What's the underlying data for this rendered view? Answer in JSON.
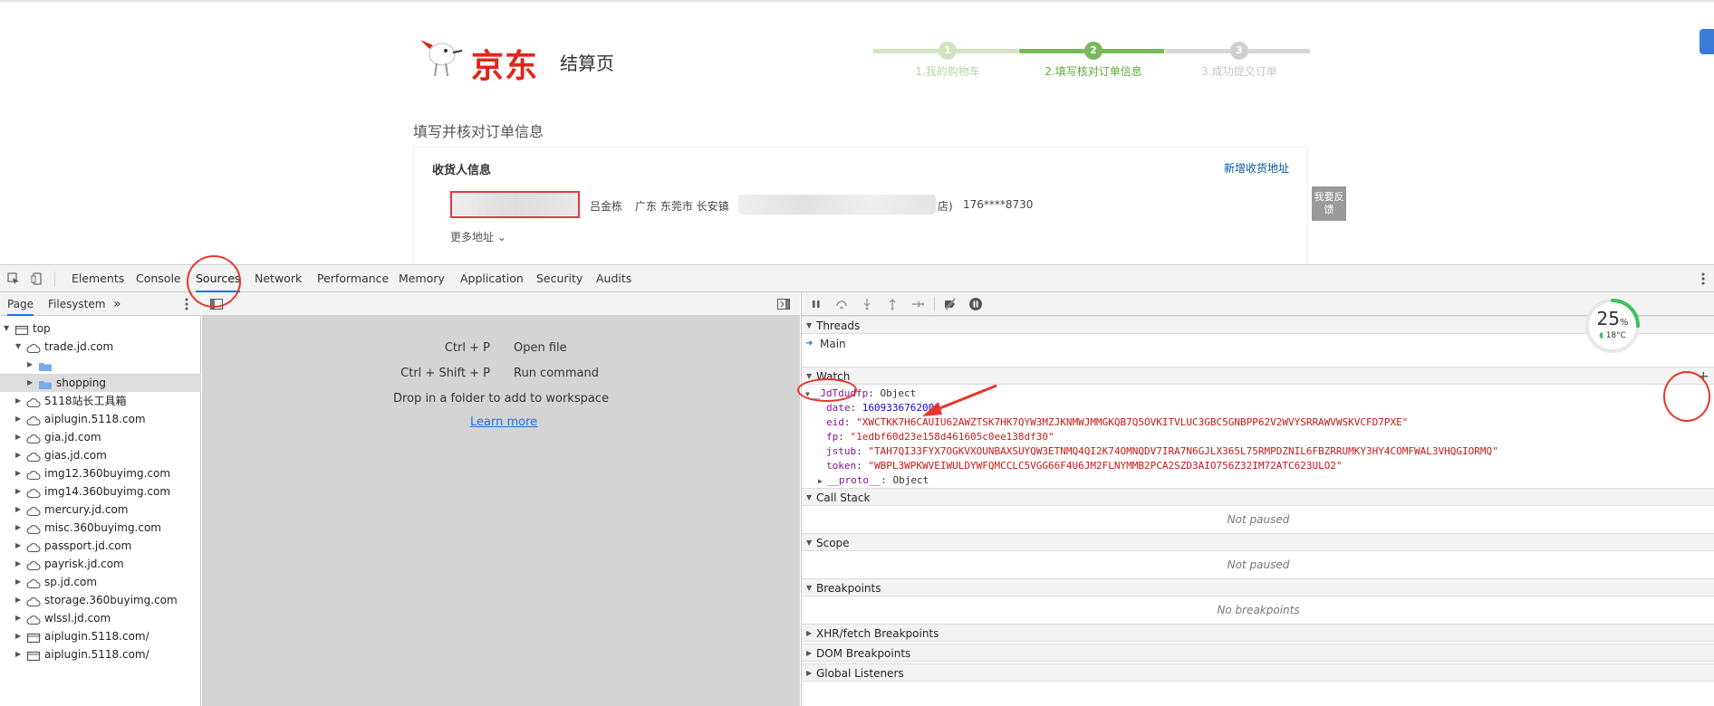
{
  "jd": {
    "brand": "京东",
    "page_subtitle": "结算页",
    "steps": [
      {
        "num": "1",
        "label": "1.我的购物车"
      },
      {
        "num": "2",
        "label": "2.填写核对订单信息"
      },
      {
        "num": "3",
        "label": "3.成功提交订单"
      }
    ],
    "section_title": "填写并核对订单信息",
    "receiver_title": "收货人信息",
    "add_address": "新增收货地址",
    "receiver_name": "吕金栋",
    "address_start": "广东 东莞市 长安镇",
    "address_end": "店)",
    "phone": "176****8730",
    "more_address": "更多地址",
    "feedback_label": "我要反馈"
  },
  "devtools": {
    "tabs": [
      "Elements",
      "Console",
      "Sources",
      "Network",
      "Performance",
      "Memory",
      "Application",
      "Security",
      "Audits"
    ],
    "active_tab": "Sources",
    "nav_tabs": [
      "Page",
      "Filesystem"
    ],
    "nav_more": "»",
    "tree": [
      {
        "label": "top",
        "indent": 0,
        "icon": "frame-icon",
        "expanded": true
      },
      {
        "label": "trade.jd.com",
        "indent": 1,
        "icon": "cloud-icon",
        "expanded": true
      },
      {
        "label": "",
        "indent": 2,
        "icon": "folder-icon",
        "expanded": false
      },
      {
        "label": "shopping",
        "indent": 2,
        "icon": "folder-icon",
        "expanded": false,
        "selected": true
      },
      {
        "label": "5118站长工具箱",
        "indent": 1,
        "icon": "cloud-icon",
        "expanded": false
      },
      {
        "label": "aiplugin.5118.com",
        "indent": 1,
        "icon": "cloud-icon",
        "expanded": false
      },
      {
        "label": "gia.jd.com",
        "indent": 1,
        "icon": "cloud-icon",
        "expanded": false
      },
      {
        "label": "gias.jd.com",
        "indent": 1,
        "icon": "cloud-icon",
        "expanded": false
      },
      {
        "label": "img12.360buyimg.com",
        "indent": 1,
        "icon": "cloud-icon",
        "expanded": false
      },
      {
        "label": "img14.360buyimg.com",
        "indent": 1,
        "icon": "cloud-icon",
        "expanded": false
      },
      {
        "label": "mercury.jd.com",
        "indent": 1,
        "icon": "cloud-icon",
        "expanded": false
      },
      {
        "label": "misc.360buyimg.com",
        "indent": 1,
        "icon": "cloud-icon",
        "expanded": false
      },
      {
        "label": "passport.jd.com",
        "indent": 1,
        "icon": "cloud-icon",
        "expanded": false
      },
      {
        "label": "payrisk.jd.com",
        "indent": 1,
        "icon": "cloud-icon",
        "expanded": false
      },
      {
        "label": "sp.jd.com",
        "indent": 1,
        "icon": "cloud-icon",
        "expanded": false
      },
      {
        "label": "storage.360buyimg.com",
        "indent": 1,
        "icon": "cloud-icon",
        "expanded": false
      },
      {
        "label": "wlssl.jd.com",
        "indent": 1,
        "icon": "cloud-icon",
        "expanded": false
      },
      {
        "label": "aiplugin.5118.com/",
        "indent": 1,
        "icon": "frame-icon",
        "expanded": false
      },
      {
        "label": "aiplugin.5118.com/",
        "indent": 1,
        "icon": "frame-icon",
        "expanded": false
      }
    ],
    "editor": {
      "shortcuts": [
        {
          "keys": "Ctrl + P",
          "action": "Open file"
        },
        {
          "keys": "Ctrl + Shift + P",
          "action": "Run command"
        }
      ],
      "drop_hint": "Drop in a folder to add to workspace",
      "learn_more": "Learn more"
    },
    "threads": {
      "title": "Threads",
      "main": "Main"
    },
    "watch": {
      "title": "Watch",
      "add": "+",
      "expr": "_JdTdudfp",
      "expr_type": "Object",
      "props": [
        {
          "key": "date",
          "value": "1609336762000",
          "kind": "num"
        },
        {
          "key": "eid",
          "value": "\"XWCTKK7H6CAUIU62AWZTSK7HK7QYW3MZJKNMWJMMGKQB7Q5OVKITVLUC3GBC5GNBPP62V2WVYSRRAWVWSKVCFD7PXE\"",
          "kind": "str"
        },
        {
          "key": "fp",
          "value": "\"1edbf60d23e158d461605c0ee138df30\"",
          "kind": "str"
        },
        {
          "key": "jstub",
          "value": "\"TAH7QI33FYX7OGKVXOUNBAXSUYQW3ETNMQ4QI2K74OMNQDV7IRA7N6GJLX365L75RMPDZNIL6FBZRRUMKY3HY4COMFWAL3VHQGIORMQ\"",
          "kind": "str"
        },
        {
          "key": "token",
          "value": "\"WBPL3WPKWVEIWULDYWFQMCCLC5VGG66F4U6JM2FLNYMMB2PCA2SZD3AIO756Z32IM72ATC623ULO2\"",
          "kind": "str"
        }
      ],
      "proto": "__proto__",
      "proto_type": "Object"
    },
    "call_stack": {
      "title": "Call Stack",
      "status": "Not paused"
    },
    "scope": {
      "title": "Scope",
      "status": "Not paused"
    },
    "breakpoints": {
      "title": "Breakpoints",
      "status": "No breakpoints"
    },
    "xhr": "XHR/fetch Breakpoints",
    "dom": "DOM Breakpoints",
    "global": "Global Listeners"
  },
  "widget": {
    "percent": "25",
    "percent_sign": "%",
    "temp": "18°C",
    "progress": 0.25
  },
  "colors": {
    "jd_red": "#e1251b",
    "step_active": "#7ab85c",
    "annotation_red": "#e8352b",
    "devtools_blue": "#1a73e8"
  }
}
